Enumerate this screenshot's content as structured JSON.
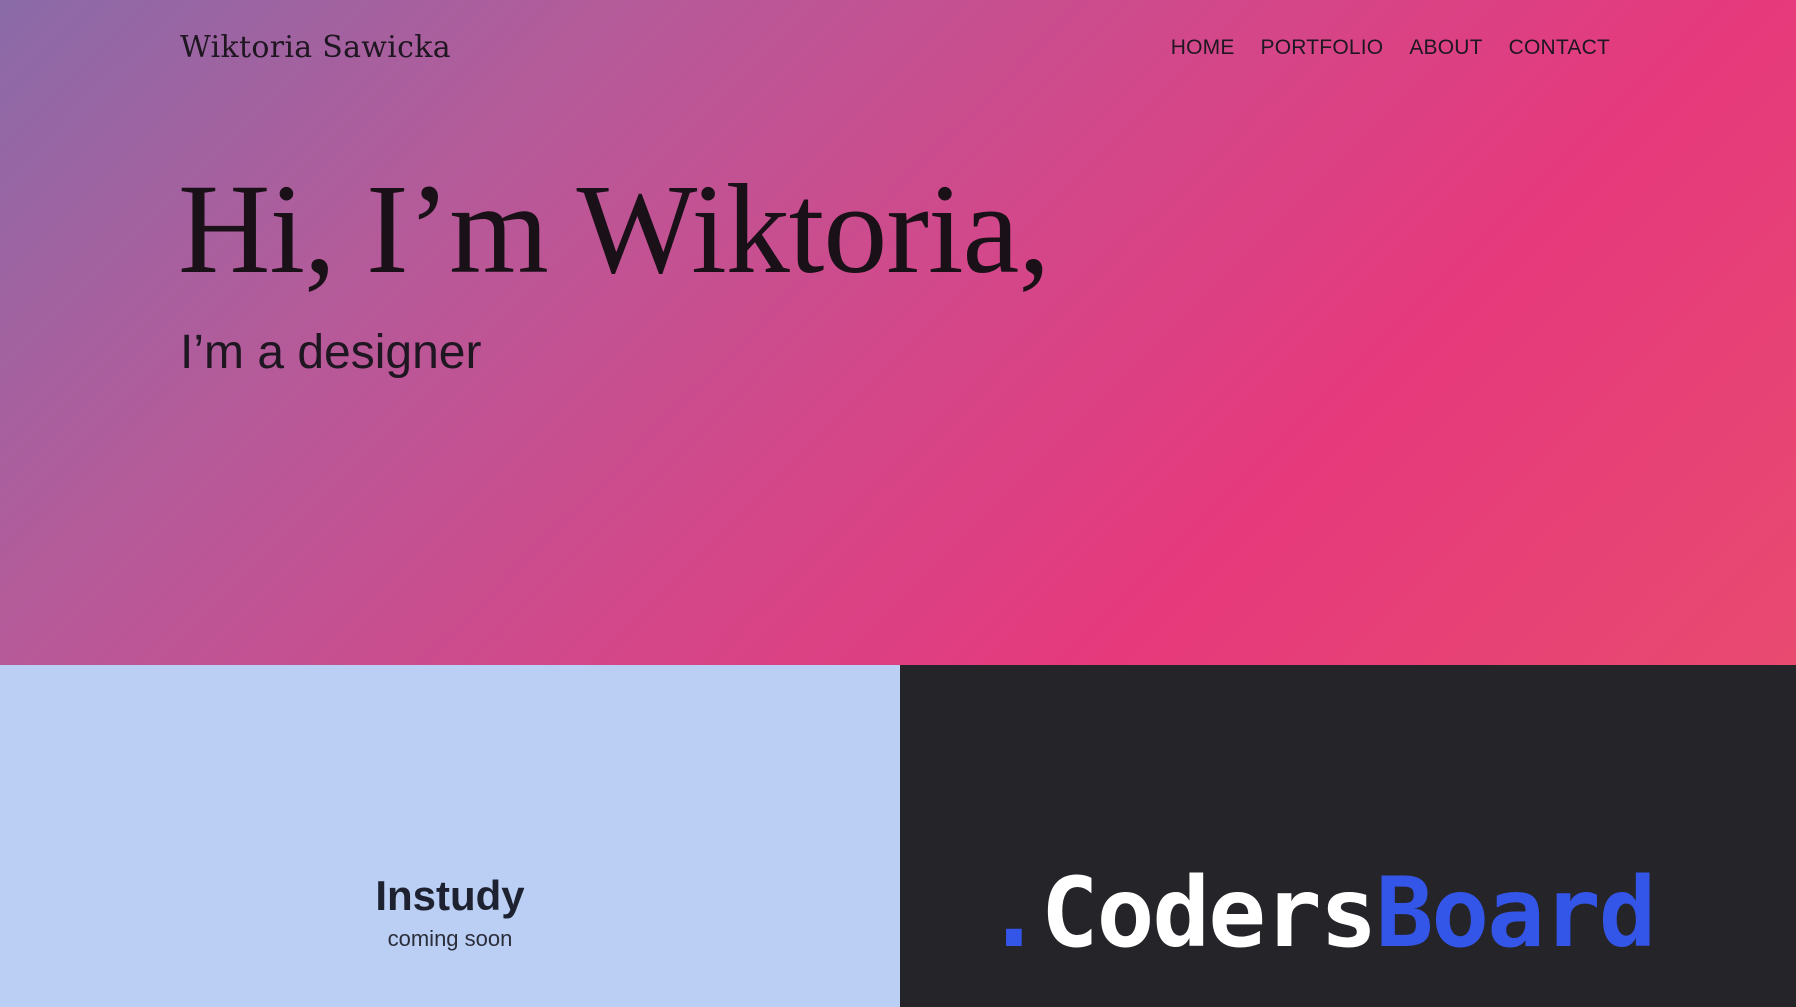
{
  "header": {
    "brand": "Wiktoria Sawicka",
    "nav": [
      "HOME",
      "PORTFOLIO",
      "ABOUT",
      "CONTACT"
    ]
  },
  "hero": {
    "title": "Hi, I’m Wiktoria,",
    "subtitle": "I’m a designer"
  },
  "projects": [
    {
      "title": "Instudy",
      "subtitle": "coming soon",
      "background": "#bbcef4"
    },
    {
      "logo_dot": ".",
      "logo_part1": "Coders",
      "logo_part2": "Board",
      "background": "#252429",
      "accent": "#3355e8"
    }
  ],
  "colors": {
    "gradient": [
      "#8a6ba8",
      "#d2488a",
      "#e6397c",
      "#e84a70"
    ],
    "text_dark": "#1e1620"
  }
}
